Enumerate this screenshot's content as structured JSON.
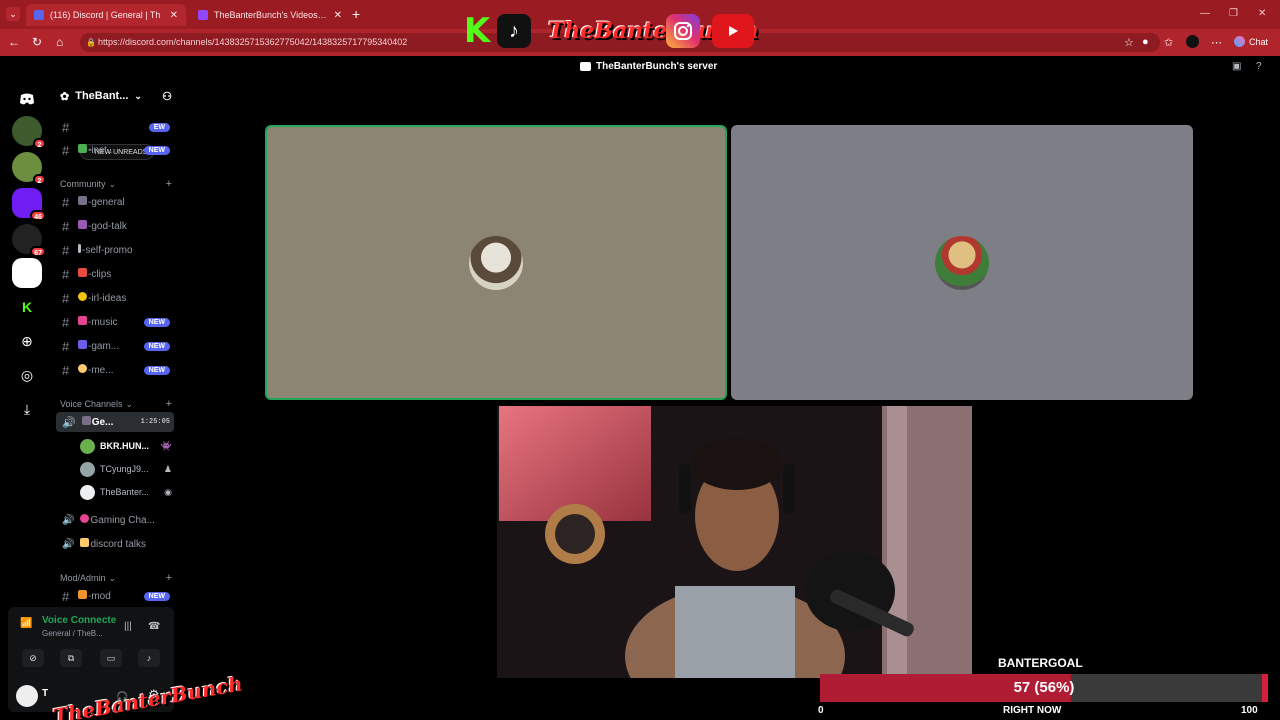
{
  "browser": {
    "tabs": [
      {
        "title": "(116) Discord | General | Th",
        "active": true
      },
      {
        "title": "TheBanterBunch's Videos - Twitch",
        "active": false
      }
    ],
    "url": "https://discord.com/channels/1438325715362775042/1438325717795340402",
    "chat_label": "Chat"
  },
  "overlay": {
    "brand": "THE BANTERBUNCH",
    "socials": [
      "kick-logo",
      "tiktok-logo",
      "instagram-logo",
      "youtube-logo"
    ]
  },
  "discord": {
    "window_title": "TheBanterBunch's server",
    "guild_name": "TheBant...",
    "unreads_label": "NEW UNREADS",
    "rail_badges": [
      "2",
      "2",
      "46",
      "67"
    ],
    "channels_top": [
      {
        "name": "",
        "new": true,
        "new_label": "EW"
      },
      {
        "name": "-inst...",
        "new": true,
        "new_label": "NEW"
      }
    ],
    "community_label": "Community",
    "community": [
      {
        "name": "-general",
        "new": false,
        "emoji_color": "#7a6f8a"
      },
      {
        "name": "-god-talk",
        "new": false,
        "emoji_color": "#9b59b6"
      },
      {
        "name": "-self-promo",
        "new": false,
        "emoji_color": "#b5bac1"
      },
      {
        "name": "-clips",
        "new": false,
        "emoji_color": "#e74c3c"
      },
      {
        "name": "-irl-ideas",
        "new": false,
        "emoji_color": "#f1c40f"
      },
      {
        "name": "-music",
        "new": true,
        "new_label": "NEW",
        "emoji_color": "#e84393"
      },
      {
        "name": "-gam...",
        "new": true,
        "new_label": "NEW",
        "emoji_color": "#6c5ce7"
      },
      {
        "name": "-me...",
        "new": true,
        "new_label": "NEW",
        "emoji_color": "#fdcb6e"
      }
    ],
    "voice_label": "Voice Channels",
    "voice_active": {
      "name": "Ge...",
      "timer": "1:25:05"
    },
    "voice_users": [
      {
        "name": "BKR.HUN...",
        "color": "#6ab04c"
      },
      {
        "name": "TCyungJ9...",
        "color": "#95a5a6"
      },
      {
        "name": "TheBanter...",
        "color": "#ecf0f1"
      }
    ],
    "voice_channels": [
      {
        "name": "Gaming Cha..."
      },
      {
        "name": "discord talks"
      }
    ],
    "mod_label": "Mod/Admin",
    "mod_channels": [
      {
        "name": "-mod",
        "new": true,
        "new_label": "NEW"
      }
    ],
    "panel": {
      "status": "Voice Connecte",
      "sub": "General / TheB...",
      "user": "T"
    }
  },
  "goal": {
    "label": "BANTERGOAL",
    "text": "57 (56%)",
    "current": 57,
    "fraction": 0.56,
    "min": "0",
    "max": "100",
    "when": "RIGHT NOW"
  }
}
